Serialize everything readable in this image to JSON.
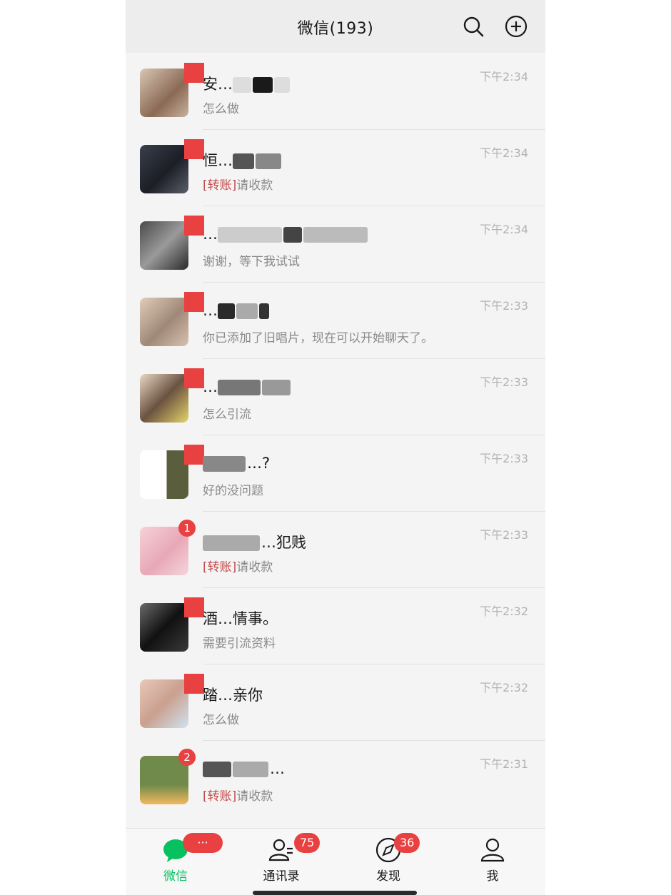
{
  "header": {
    "title": "微信(193)"
  },
  "icons": {
    "search": "search-icon",
    "add": "plus-circle-icon"
  },
  "chats": [
    {
      "name": "安…",
      "message": "怎么做",
      "tag": "",
      "time": "下午2:34",
      "badge": ""
    },
    {
      "name": "恒…",
      "message": "请收款",
      "tag": "[转账]",
      "time": "下午2:34",
      "badge": ""
    },
    {
      "name": "…",
      "message": "谢谢，等下我试试",
      "tag": "",
      "time": "下午2:34",
      "badge": ""
    },
    {
      "name": "…",
      "message": "你已添加了旧唱片，现在可以开始聊天了。",
      "tag": "",
      "time": "下午2:33",
      "badge": ""
    },
    {
      "name": "…",
      "message": "怎么引流",
      "tag": "",
      "time": "下午2:33",
      "badge": ""
    },
    {
      "name": "…?",
      "message": "好的没问题",
      "tag": "",
      "time": "下午2:33",
      "badge": ""
    },
    {
      "name": "…犯贱",
      "message": "请收款",
      "tag": "[转账]",
      "time": "下午2:33",
      "badge": "1"
    },
    {
      "name": "酒…情事。",
      "message": "需要引流资料",
      "tag": "",
      "time": "下午2:32",
      "badge": ""
    },
    {
      "name": "踏…亲你",
      "message": "怎么做",
      "tag": "",
      "time": "下午2:32",
      "badge": ""
    },
    {
      "name": "…",
      "message": "请收款",
      "tag": "[转账]",
      "time": "下午2:31",
      "badge": "2"
    }
  ],
  "tabs": [
    {
      "label": "微信",
      "badge": "···",
      "icon": "chat-bubble-icon",
      "active": true
    },
    {
      "label": "通讯录",
      "badge": "75",
      "icon": "contacts-icon",
      "active": false
    },
    {
      "label": "发现",
      "badge": "36",
      "icon": "compass-icon",
      "active": false
    },
    {
      "label": "我",
      "badge": "",
      "icon": "person-icon",
      "active": false
    }
  ],
  "colors": {
    "accent": "#07c160",
    "badge": "#e94141",
    "header_bg": "#ededed"
  }
}
